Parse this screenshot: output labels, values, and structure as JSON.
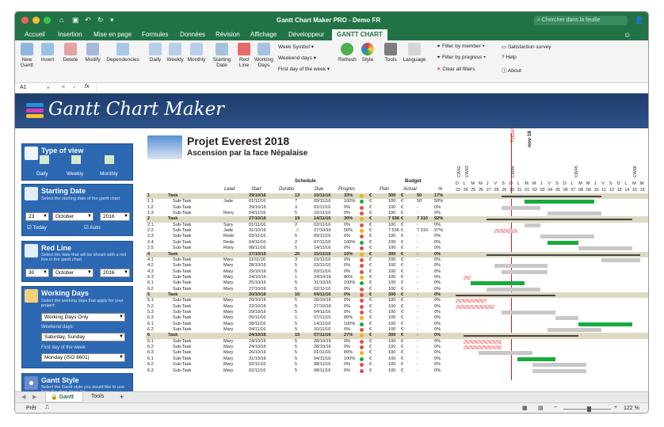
{
  "window": {
    "title": "Gantt Chart Maker PRO - Demo FR",
    "search_placeholder": "Chercher dans la feuille"
  },
  "tabs": [
    "Accueil",
    "Insertion",
    "Mise en page",
    "Formules",
    "Données",
    "Révision",
    "Affichage",
    "Développeur",
    "GANTT CHART"
  ],
  "ribbon": {
    "buttons": [
      "New Gantt",
      "Insert",
      "Delete",
      "Modify",
      "Dependencies",
      "Daily",
      "Weekly",
      "Monthly",
      "Starting Date",
      "Red Line",
      "Working Days",
      "Refresh",
      "Style",
      "Tools",
      "Language"
    ],
    "dropdowns": [
      "Week Symbol",
      "Weekend days",
      "First day of the week"
    ],
    "filters": [
      "Filter by member",
      "Filter by progress",
      "Clear all filters"
    ],
    "links": [
      "Satisfaction survey",
      "Help",
      "About"
    ]
  },
  "formula_bar": {
    "cell_ref": "A1",
    "fx": "fx"
  },
  "banner": {
    "title": "Gantt Chart Maker"
  },
  "panels": {
    "view": {
      "title": "Type of view",
      "options": [
        "Daily",
        "Weekly",
        "Monthly"
      ]
    },
    "start": {
      "title": "Starting Date",
      "desc": "Select the starting date of the gantt chart",
      "day": "23",
      "month": "October",
      "year": "2016",
      "today": "Today",
      "auto": "Auto"
    },
    "redline": {
      "title": "Red Line",
      "desc": "Select the date that will be shown with a red line in the gantt chart",
      "day": "30",
      "month": "October",
      "year": "2016"
    },
    "working": {
      "title": "Working Days",
      "desc": "Select the working days that apply for your project:",
      "value": "Working Days Only",
      "weekend_label": "Weekend days:",
      "weekend": "Saturday, Sunday",
      "first_label": "First day of the week:",
      "first": "Monday (ISO 8601)"
    },
    "style": {
      "title": "Gantt Style",
      "desc": "Select the Gantt style you would like to use from the drop-down list"
    }
  },
  "project": {
    "title": "Projet Everest 2018",
    "subtitle": "Ascension par la face Népalaise"
  },
  "headers": {
    "schedule": "Schedule",
    "budget": "Budget",
    "lead": "Lead",
    "start": "Start",
    "duration": "Duratio",
    "due": "Due",
    "progress": "Progres",
    "plan": "Plan",
    "actual": "Actual",
    "pct": "%",
    "today": "TODAY",
    "month": "nov-16"
  },
  "week_labels": [
    "CW42",
    "CW43",
    "CW44",
    "CW45",
    "CW46"
  ],
  "day_letters": [
    "D",
    "L",
    "M",
    "M",
    "J",
    "V",
    "S",
    "D",
    "L",
    "M",
    "M",
    "J",
    "V",
    "S",
    "D",
    "L",
    "M",
    "M",
    "J",
    "V",
    "S",
    "D",
    "L",
    "M",
    "M",
    "J",
    "V",
    "S",
    "D",
    "L",
    "M",
    "M",
    "J"
  ],
  "day_numbers": [
    "23",
    "24",
    "25",
    "26",
    "27",
    "28",
    "29",
    "30",
    "31",
    "01",
    "02",
    "03",
    "04",
    "05",
    "06",
    "07",
    "08",
    "09",
    "10",
    "11",
    "12",
    "13",
    "14",
    "15",
    "16"
  ],
  "rows": [
    {
      "id": "1",
      "name": "Task",
      "lead": "",
      "start": "29/10/16",
      "dur": "13",
      "due": "10/11/16",
      "prog": "33%",
      "plan": "300",
      "actual": "50",
      "pct": "17%",
      "task": true
    },
    {
      "id": "1.1",
      "name": "Sub-Task",
      "lead": "Jade",
      "start": "01/11/16",
      "dur": "7",
      "due": "09/11/16",
      "prog": "100%",
      "plan": "100",
      "actual": "50",
      "pct": "50%"
    },
    {
      "id": "1.2",
      "name": "Sub-Task",
      "lead": "",
      "start": "29/10/16",
      "dur": "3",
      "due": "02/11/16",
      "prog": "0%",
      "plan": "100",
      "actual": "-",
      "pct": "0%"
    },
    {
      "id": "1.3",
      "name": "Sub-Task",
      "lead": "Rony",
      "start": "04/11/16",
      "dur": "5",
      "due": "10/11/16",
      "prog": "0%",
      "plan": "100",
      "actual": "-",
      "pct": "0%"
    },
    {
      "id": "2",
      "name": "Task",
      "lead": "",
      "start": "27/10/16",
      "dur": "19",
      "due": "14/11/16",
      "prog": "30%",
      "plan": "7 936",
      "actual": "7 310",
      "pct": "92%",
      "task": true
    },
    {
      "id": "2.1",
      "name": "Sub-Task",
      "lead": "Sara",
      "start": "01/11/16",
      "dur": "2",
      "due": "02/11/16",
      "prog": "0%",
      "plan": "100",
      "actual": "-",
      "pct": "0%"
    },
    {
      "id": "2.2",
      "name": "Sub-Task",
      "lead": "Jade",
      "start": "31/10/16",
      "dur": "-3",
      "due": "27/10/16",
      "prog": "50%",
      "plan": "7 536",
      "actual": "7 310",
      "pct": "97%"
    },
    {
      "id": "2.3",
      "name": "Sub-Task",
      "lead": "Rede",
      "start": "03/11/16",
      "dur": "5",
      "due": "09/11/16",
      "prog": "0%",
      "plan": "100",
      "actual": "-",
      "pct": "0%"
    },
    {
      "id": "2.4",
      "name": "Sub-Task",
      "lead": "Rede",
      "start": "04/11/16",
      "dur": "2",
      "due": "07/11/16",
      "prog": "100%",
      "plan": "100",
      "actual": "-",
      "pct": "0%"
    },
    {
      "id": "2.5",
      "name": "Sub-Task",
      "lead": "Rony",
      "start": "08/11/16",
      "dur": "5",
      "due": "14/11/16",
      "prog": "0%",
      "plan": "100",
      "actual": "-",
      "pct": "0%"
    },
    {
      "id": "4",
      "name": "Task",
      "lead": "",
      "start": "27/10/16",
      "dur": "20",
      "due": "15/11/16",
      "prog": "10%",
      "plan": "300",
      "actual": "-",
      "pct": "0%",
      "task": true
    },
    {
      "id": "4.1",
      "name": "Sub-Task",
      "lead": "Mary",
      "start": "11/11/16",
      "dur": "3",
      "due": "15/11/16",
      "prog": "0%",
      "plan": "100",
      "actual": "-",
      "pct": "0%"
    },
    {
      "id": "4.2",
      "name": "Sub-Task",
      "lead": "Mary",
      "start": "28/10/16",
      "dur": "5",
      "due": "03/11/16",
      "prog": "0%",
      "plan": "100",
      "actual": "-",
      "pct": "0%"
    },
    {
      "id": "4.3",
      "name": "Sub-Task",
      "lead": "Mary",
      "start": "29/10/16",
      "dur": "5",
      "due": "03/11/16",
      "prog": "0%",
      "plan": "100",
      "actual": "-",
      "pct": "0%"
    },
    {
      "id": "6.3",
      "name": "Sub-Task",
      "lead": "Mary",
      "start": "24/10/16",
      "dur": "1",
      "due": "24/10/16",
      "prog": "80%",
      "plan": "100",
      "actual": "-",
      "pct": "0%"
    },
    {
      "id": "6.1",
      "name": "Sub-Task",
      "lead": "Mary",
      "start": "25/10/16",
      "dur": "5",
      "due": "31/10/16",
      "prog": "100%",
      "plan": "100",
      "actual": "-",
      "pct": "0%"
    },
    {
      "id": "6.2",
      "name": "Sub-Task",
      "lead": "Mary",
      "start": "27/10/16",
      "dur": "5",
      "due": "02/11/16",
      "prog": "0%",
      "plan": "100",
      "actual": "-",
      "pct": "0%"
    },
    {
      "id": "5",
      "name": "Task",
      "lead": "",
      "start": "20/10/16",
      "dur": "16",
      "due": "04/11/16",
      "prog": "0%",
      "plan": "300",
      "actual": "-",
      "pct": "0%",
      "task": true
    },
    {
      "id": "5.1",
      "name": "Sub-Task",
      "lead": "Mary",
      "start": "20/10/16",
      "dur": "5",
      "due": "26/10/16",
      "prog": "0%",
      "plan": "100",
      "actual": "-",
      "pct": "0%"
    },
    {
      "id": "5.2",
      "name": "Sub-Task",
      "lead": "Mary",
      "start": "22/10/16",
      "dur": "5",
      "due": "27/10/16",
      "prog": "0%",
      "plan": "100",
      "actual": "-",
      "pct": "0%"
    },
    {
      "id": "5.3",
      "name": "Sub-Task",
      "lead": "Mary",
      "start": "29/10/16",
      "dur": "5",
      "due": "04/11/16",
      "prog": "0%",
      "plan": "100",
      "actual": "-",
      "pct": "0%"
    },
    {
      "id": "6.3",
      "name": "Sub-Task",
      "lead": "Mary",
      "start": "05/11/16",
      "dur": "1",
      "due": "07/11/16",
      "prog": "80%",
      "plan": "100",
      "actual": "-",
      "pct": "0%"
    },
    {
      "id": "6.1",
      "name": "Sub-Task",
      "lead": "Mary",
      "start": "08/11/16",
      "dur": "5",
      "due": "14/11/16",
      "prog": "100%",
      "plan": "100",
      "actual": "-",
      "pct": "0%"
    },
    {
      "id": "6.2",
      "name": "Sub-Task",
      "lead": "Mary",
      "start": "04/11/16",
      "dur": "5",
      "due": "10/11/16",
      "prog": "0%",
      "plan": "100",
      "actual": "-",
      "pct": "0%"
    },
    {
      "id": "6",
      "name": "Task",
      "lead": "",
      "start": "24/10/16",
      "dur": "15",
      "due": "07/11/16",
      "prog": "27%",
      "plan": "300",
      "actual": "-",
      "pct": "0%",
      "task": true
    },
    {
      "id": "6.1",
      "name": "Sub-Task",
      "lead": "Mary",
      "start": "24/10/16",
      "dur": "5",
      "due": "28/10/16",
      "prog": "0%",
      "plan": "100",
      "actual": "-",
      "pct": "0%"
    },
    {
      "id": "6.2",
      "name": "Sub-Task",
      "lead": "Mary",
      "start": "24/10/16",
      "dur": "5",
      "due": "28/10/16",
      "prog": "0%",
      "plan": "100",
      "actual": "-",
      "pct": "0%"
    },
    {
      "id": "6.3",
      "name": "Sub-Task",
      "lead": "Mary",
      "start": "26/10/16",
      "dur": "5",
      "due": "01/11/16",
      "prog": "80%",
      "plan": "100",
      "actual": "-",
      "pct": "0%"
    },
    {
      "id": "6.1",
      "name": "Sub-Task",
      "lead": "Mary",
      "start": "31/10/16",
      "dur": "5",
      "due": "04/11/16",
      "prog": "100%",
      "plan": "100",
      "actual": "-",
      "pct": "0%"
    },
    {
      "id": "6.2",
      "name": "Sub-Task",
      "lead": "Mary",
      "start": "02/11/16",
      "dur": "5",
      "due": "08/11/16",
      "prog": "0%",
      "plan": "100",
      "actual": "-",
      "pct": "0%"
    },
    {
      "id": "6.3",
      "name": "Sub-Task",
      "lead": "Mary",
      "start": "02/11/16",
      "dur": "5",
      "due": "08/11/16",
      "prog": "0%",
      "plan": "100",
      "actual": "-",
      "pct": "0%"
    }
  ],
  "sheet_tabs": [
    "Gantt",
    "Tools",
    "+"
  ],
  "status": {
    "ready": "Prêt",
    "zoom": "122 %"
  },
  "colors": {
    "excel_green": "#217346",
    "task_row": "#ddd9c3",
    "done_bar": "#1aaa3d",
    "plan_bar": "#c8c8c8",
    "late_bar": "#f3a6a6",
    "red_line": "#e01b1b",
    "panel_blue": "#2d69b3"
  }
}
